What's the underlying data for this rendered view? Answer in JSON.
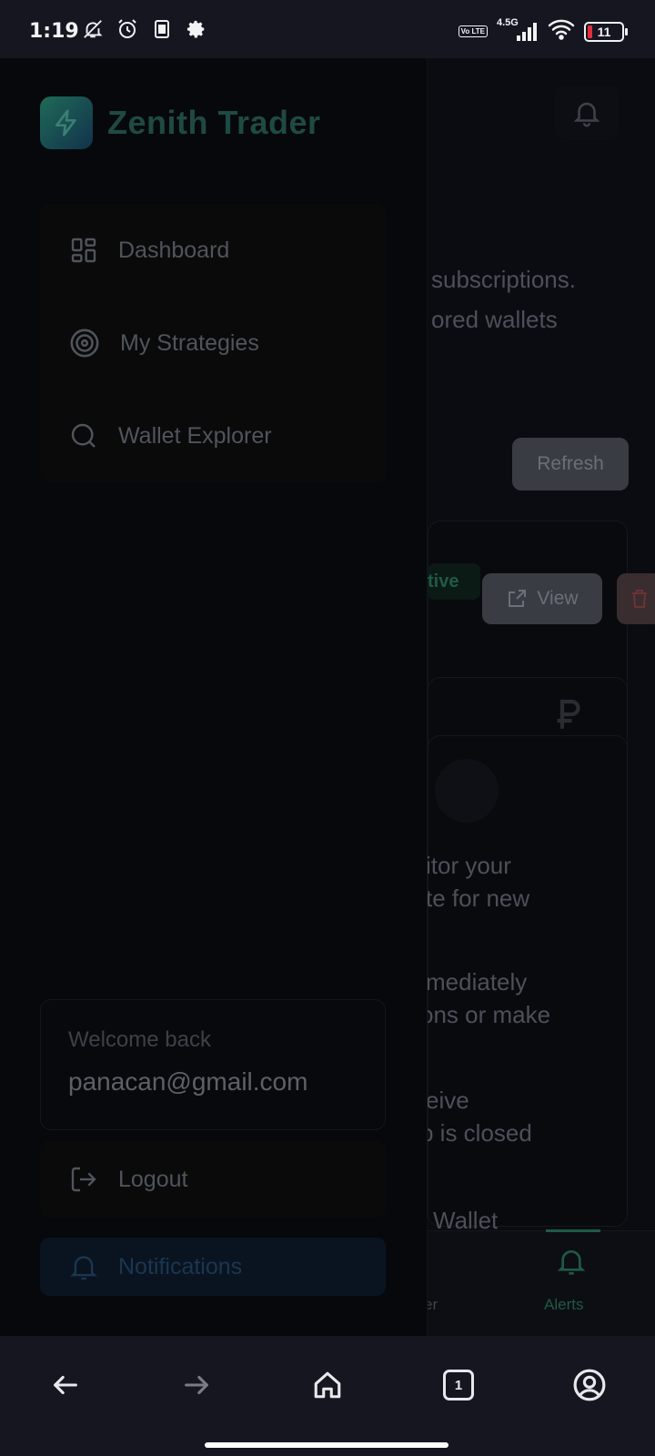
{
  "status_bar": {
    "time": "1:19",
    "network": "4.5G",
    "volte": "Vo LTE",
    "battery": "11"
  },
  "background": {
    "text_lines": [
      "subscriptions.",
      "ored wallets",
      "itor your",
      "te for new",
      "mediately",
      "ons or make",
      "eive",
      "p is closed",
      "Wallet"
    ],
    "refresh_label": "Refresh",
    "view_label": "View",
    "active_badge": "tive",
    "nav_partial": "er",
    "nav_alerts": "Alerts"
  },
  "drawer": {
    "brand": "Zenith Trader",
    "menu": [
      {
        "label": "Dashboard",
        "icon": "grid-icon"
      },
      {
        "label": "My Strategies",
        "icon": "target-icon"
      },
      {
        "label": "Wallet Explorer",
        "icon": "search-icon"
      }
    ],
    "welcome_label": "Welcome back",
    "user_email": "panacan@gmail.com",
    "logout_label": "Logout",
    "notifications_label": "Notifications"
  },
  "browser_bar": {
    "tab_count": "1"
  },
  "colors": {
    "accent": "#1f5a45",
    "drawer_bg": "#07080b",
    "statusbar_bg": "#161621"
  }
}
